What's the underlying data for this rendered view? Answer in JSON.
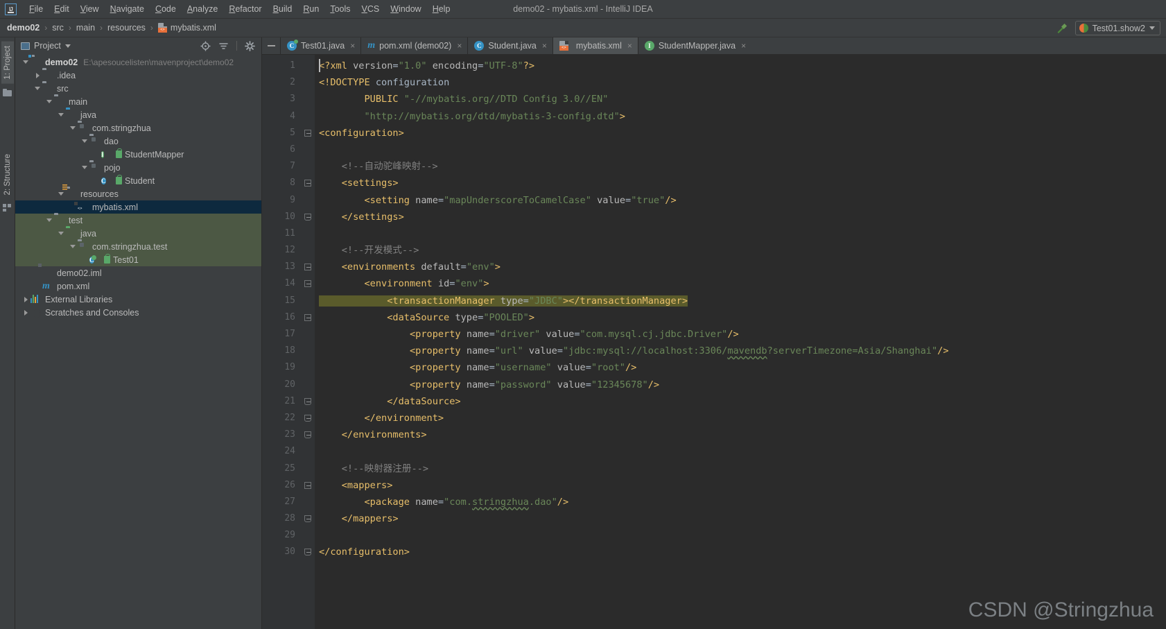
{
  "window": {
    "title": "demo02 - mybatis.xml - IntelliJ IDEA",
    "logo": "ij-logo"
  },
  "menu": [
    {
      "label": "File"
    },
    {
      "label": "Edit"
    },
    {
      "label": "View"
    },
    {
      "label": "Navigate"
    },
    {
      "label": "Code"
    },
    {
      "label": "Analyze"
    },
    {
      "label": "Refactor"
    },
    {
      "label": "Build"
    },
    {
      "label": "Run"
    },
    {
      "label": "Tools"
    },
    {
      "label": "VCS"
    },
    {
      "label": "Window"
    },
    {
      "label": "Help"
    }
  ],
  "breadcrumb": {
    "items": [
      {
        "label": "demo02",
        "bold": true
      },
      {
        "label": "src",
        "bold": false
      },
      {
        "label": "main",
        "bold": false
      },
      {
        "label": "resources",
        "bold": false
      },
      {
        "label": "mybatis.xml",
        "bold": false,
        "icon": "xml-file-icon"
      }
    ],
    "separator": "›"
  },
  "toolbar_right": {
    "build_icon": "hammer-icon",
    "run_config": "Test01.show2",
    "run_config_icon": "run-debug-icon",
    "dropdown_icon": "chevron-down-icon"
  },
  "rail": {
    "top_tab": "1: Project",
    "bottom_tab": "2: Structure"
  },
  "project_panel": {
    "title": "Project",
    "title_icon": "project-view-icon",
    "dropdown_icon": "chevron-down-icon",
    "actions": [
      {
        "name": "locate-icon"
      },
      {
        "name": "collapse-all-icon"
      },
      {
        "name": "gear-icon"
      }
    ],
    "tree": [
      {
        "indent": 0,
        "twisty": "down",
        "icon": "module-folder",
        "label": "demo02",
        "bold": true,
        "path": "E:\\apesoucelisten\\mavenproject\\demo02"
      },
      {
        "indent": 1,
        "twisty": "right",
        "icon": "folder",
        "label": ".idea"
      },
      {
        "indent": 1,
        "twisty": "down",
        "icon": "folder",
        "label": "src"
      },
      {
        "indent": 2,
        "twisty": "down",
        "icon": "folder",
        "label": "main"
      },
      {
        "indent": 3,
        "twisty": "down",
        "icon": "folder-source",
        "label": "java"
      },
      {
        "indent": 4,
        "twisty": "down",
        "icon": "package",
        "label": "com.stringzhua"
      },
      {
        "indent": 5,
        "twisty": "down",
        "icon": "package",
        "label": "dao"
      },
      {
        "indent": 6,
        "twisty": "none",
        "icon": "interface",
        "label": "StudentMapper",
        "lock": true
      },
      {
        "indent": 5,
        "twisty": "down",
        "icon": "package",
        "label": "pojo"
      },
      {
        "indent": 6,
        "twisty": "none",
        "icon": "class",
        "label": "Student",
        "lock": true
      },
      {
        "indent": 3,
        "twisty": "down",
        "icon": "folder-resources",
        "label": "resources"
      },
      {
        "indent": 4,
        "twisty": "none",
        "icon": "xml-file",
        "label": "mybatis.xml",
        "selected": true
      },
      {
        "indent": 2,
        "twisty": "down",
        "icon": "folder",
        "label": "test",
        "testroot": true
      },
      {
        "indent": 3,
        "twisty": "down",
        "icon": "folder-test",
        "label": "java",
        "testroot": true
      },
      {
        "indent": 4,
        "twisty": "down",
        "icon": "package",
        "label": "com.stringzhua.test",
        "testroot": true
      },
      {
        "indent": 5,
        "twisty": "none",
        "icon": "class-runnable",
        "label": "Test01",
        "lock": true,
        "testroot": true
      },
      {
        "indent": 1,
        "twisty": "none",
        "icon": "iml-file",
        "label": "demo02.iml"
      },
      {
        "indent": 1,
        "twisty": "none",
        "icon": "maven-file",
        "label": "pom.xml"
      },
      {
        "indent": 0,
        "twisty": "right",
        "icon": "libraries",
        "label": "External Libraries"
      },
      {
        "indent": 0,
        "twisty": "right",
        "icon": "scratches",
        "label": "Scratches and Consoles"
      }
    ]
  },
  "editor_tabs": {
    "minimize_icon": "minus-icon",
    "tabs": [
      {
        "label": "Test01.java",
        "icon": "java-runnable-class-icon",
        "active": false,
        "close": "×"
      },
      {
        "label": "pom.xml (demo02)",
        "icon": "maven-icon",
        "active": false,
        "close": "×"
      },
      {
        "label": "Student.java",
        "icon": "class-icon",
        "active": false,
        "close": "×"
      },
      {
        "label": "mybatis.xml",
        "icon": "xml-file-icon",
        "active": true,
        "close": "×"
      },
      {
        "label": "StudentMapper.java",
        "icon": "interface-icon",
        "active": false,
        "close": "×"
      }
    ]
  },
  "editor": {
    "language": "xml",
    "filename": "mybatis.xml",
    "first_line": 1,
    "last_line": 30,
    "caret_line": 1,
    "selection_line": 15,
    "lines": [
      {
        "n": 1,
        "fold": "none",
        "tokens": [
          {
            "t": "pi",
            "v": "<?xml "
          },
          {
            "t": "attr",
            "v": "version"
          },
          {
            "t": "plain",
            "v": "="
          },
          {
            "t": "str",
            "v": "\"1.0\""
          },
          {
            "t": "plain",
            "v": " "
          },
          {
            "t": "attr",
            "v": "encoding"
          },
          {
            "t": "plain",
            "v": "="
          },
          {
            "t": "str",
            "v": "\"UTF-8\""
          },
          {
            "t": "pi",
            "v": "?>"
          }
        ]
      },
      {
        "n": 2,
        "fold": "none",
        "tokens": [
          {
            "t": "tag",
            "v": "<!DOCTYPE"
          },
          {
            "t": "plain",
            "v": " configuration"
          }
        ]
      },
      {
        "n": 3,
        "fold": "none",
        "tokens": [
          {
            "t": "plain",
            "v": "        "
          },
          {
            "t": "tag",
            "v": "PUBLIC"
          },
          {
            "t": "plain",
            "v": " "
          },
          {
            "t": "str",
            "v": "\"-//mybatis.org//DTD Config 3.0//EN\""
          }
        ]
      },
      {
        "n": 4,
        "fold": "none",
        "tokens": [
          {
            "t": "plain",
            "v": "        "
          },
          {
            "t": "str",
            "v": "\"http://mybatis.org/dtd/mybatis-3-config.dtd\""
          },
          {
            "t": "tag",
            "v": ">"
          }
        ]
      },
      {
        "n": 5,
        "fold": "start",
        "tokens": [
          {
            "t": "tag",
            "v": "<configuration>"
          }
        ]
      },
      {
        "n": 6,
        "fold": "none",
        "tokens": []
      },
      {
        "n": 7,
        "fold": "none",
        "tokens": [
          {
            "t": "plain",
            "v": "    "
          },
          {
            "t": "cmt",
            "v": "<!--自动驼峰映射-->"
          }
        ]
      },
      {
        "n": 8,
        "fold": "start",
        "tokens": [
          {
            "t": "plain",
            "v": "    "
          },
          {
            "t": "tag",
            "v": "<settings>"
          }
        ]
      },
      {
        "n": 9,
        "fold": "none",
        "tokens": [
          {
            "t": "plain",
            "v": "        "
          },
          {
            "t": "tag",
            "v": "<setting"
          },
          {
            "t": "plain",
            "v": " "
          },
          {
            "t": "attr",
            "v": "name"
          },
          {
            "t": "plain",
            "v": "="
          },
          {
            "t": "str",
            "v": "\"mapUnderscoreToCamelCase\""
          },
          {
            "t": "plain",
            "v": " "
          },
          {
            "t": "attr",
            "v": "value"
          },
          {
            "t": "plain",
            "v": "="
          },
          {
            "t": "str",
            "v": "\"true\""
          },
          {
            "t": "tag",
            "v": "/>"
          }
        ]
      },
      {
        "n": 10,
        "fold": "end",
        "tokens": [
          {
            "t": "plain",
            "v": "    "
          },
          {
            "t": "tag",
            "v": "</settings>"
          }
        ]
      },
      {
        "n": 11,
        "fold": "none",
        "tokens": []
      },
      {
        "n": 12,
        "fold": "none",
        "tokens": [
          {
            "t": "plain",
            "v": "    "
          },
          {
            "t": "cmt",
            "v": "<!--开发模式-->"
          }
        ]
      },
      {
        "n": 13,
        "fold": "start",
        "tokens": [
          {
            "t": "plain",
            "v": "    "
          },
          {
            "t": "tag",
            "v": "<environments"
          },
          {
            "t": "plain",
            "v": " "
          },
          {
            "t": "attr",
            "v": "default"
          },
          {
            "t": "plain",
            "v": "="
          },
          {
            "t": "str",
            "v": "\"env\""
          },
          {
            "t": "tag",
            "v": ">"
          }
        ]
      },
      {
        "n": 14,
        "fold": "start",
        "tokens": [
          {
            "t": "plain",
            "v": "        "
          },
          {
            "t": "tag",
            "v": "<environment"
          },
          {
            "t": "plain",
            "v": " "
          },
          {
            "t": "attr",
            "v": "id"
          },
          {
            "t": "plain",
            "v": "="
          },
          {
            "t": "str",
            "v": "\"env\""
          },
          {
            "t": "tag",
            "v": ">"
          }
        ]
      },
      {
        "n": 15,
        "fold": "none",
        "selected": true,
        "tokens": [
          {
            "t": "plain",
            "v": "            "
          },
          {
            "t": "tag",
            "v": "<transactionManager"
          },
          {
            "t": "plain",
            "v": " "
          },
          {
            "t": "attr",
            "v": "type"
          },
          {
            "t": "plain",
            "v": "="
          },
          {
            "t": "str",
            "v": "\"JDBC\""
          },
          {
            "t": "tag",
            "v": "></transactionManager>"
          }
        ]
      },
      {
        "n": 16,
        "fold": "start",
        "tokens": [
          {
            "t": "plain",
            "v": "            "
          },
          {
            "t": "tag",
            "v": "<dataSource"
          },
          {
            "t": "plain",
            "v": " "
          },
          {
            "t": "attr",
            "v": "type"
          },
          {
            "t": "plain",
            "v": "="
          },
          {
            "t": "str",
            "v": "\"POOLED\""
          },
          {
            "t": "tag",
            "v": ">"
          }
        ]
      },
      {
        "n": 17,
        "fold": "none",
        "tokens": [
          {
            "t": "plain",
            "v": "                "
          },
          {
            "t": "tag",
            "v": "<property"
          },
          {
            "t": "plain",
            "v": " "
          },
          {
            "t": "attr",
            "v": "name"
          },
          {
            "t": "plain",
            "v": "="
          },
          {
            "t": "str",
            "v": "\"driver\""
          },
          {
            "t": "plain",
            "v": " "
          },
          {
            "t": "attr",
            "v": "value"
          },
          {
            "t": "plain",
            "v": "="
          },
          {
            "t": "str",
            "v": "\"com.mysql.cj.jdbc.Driver\""
          },
          {
            "t": "tag",
            "v": "/>"
          }
        ]
      },
      {
        "n": 18,
        "fold": "none",
        "tokens": [
          {
            "t": "plain",
            "v": "                "
          },
          {
            "t": "tag",
            "v": "<property"
          },
          {
            "t": "plain",
            "v": " "
          },
          {
            "t": "attr",
            "v": "name"
          },
          {
            "t": "plain",
            "v": "="
          },
          {
            "t": "str",
            "v": "\"url\""
          },
          {
            "t": "plain",
            "v": " "
          },
          {
            "t": "attr",
            "v": "value"
          },
          {
            "t": "plain",
            "v": "="
          },
          {
            "t": "str",
            "v": "\"jdbc:mysql://localhost:3306/"
          },
          {
            "t": "str-warn",
            "v": "mavendb"
          },
          {
            "t": "str",
            "v": "?serverTimezone=Asia/Shanghai\""
          },
          {
            "t": "tag",
            "v": "/>"
          }
        ]
      },
      {
        "n": 19,
        "fold": "none",
        "tokens": [
          {
            "t": "plain",
            "v": "                "
          },
          {
            "t": "tag",
            "v": "<property"
          },
          {
            "t": "plain",
            "v": " "
          },
          {
            "t": "attr",
            "v": "name"
          },
          {
            "t": "plain",
            "v": "="
          },
          {
            "t": "str",
            "v": "\"username\""
          },
          {
            "t": "plain",
            "v": " "
          },
          {
            "t": "attr",
            "v": "value"
          },
          {
            "t": "plain",
            "v": "="
          },
          {
            "t": "str",
            "v": "\"root\""
          },
          {
            "t": "tag",
            "v": "/>"
          }
        ]
      },
      {
        "n": 20,
        "fold": "none",
        "tokens": [
          {
            "t": "plain",
            "v": "                "
          },
          {
            "t": "tag",
            "v": "<property"
          },
          {
            "t": "plain",
            "v": " "
          },
          {
            "t": "attr",
            "v": "name"
          },
          {
            "t": "plain",
            "v": "="
          },
          {
            "t": "str",
            "v": "\"password\""
          },
          {
            "t": "plain",
            "v": " "
          },
          {
            "t": "attr",
            "v": "value"
          },
          {
            "t": "plain",
            "v": "="
          },
          {
            "t": "str",
            "v": "\"12345678\""
          },
          {
            "t": "tag",
            "v": "/>"
          }
        ]
      },
      {
        "n": 21,
        "fold": "end",
        "tokens": [
          {
            "t": "plain",
            "v": "            "
          },
          {
            "t": "tag",
            "v": "</dataSource>"
          }
        ]
      },
      {
        "n": 22,
        "fold": "end",
        "tokens": [
          {
            "t": "plain",
            "v": "        "
          },
          {
            "t": "tag",
            "v": "</environment>"
          }
        ]
      },
      {
        "n": 23,
        "fold": "end",
        "tokens": [
          {
            "t": "plain",
            "v": "    "
          },
          {
            "t": "tag",
            "v": "</environments>"
          }
        ]
      },
      {
        "n": 24,
        "fold": "none",
        "tokens": []
      },
      {
        "n": 25,
        "fold": "none",
        "tokens": [
          {
            "t": "plain",
            "v": "    "
          },
          {
            "t": "cmt",
            "v": "<!--映射器注册-->"
          }
        ]
      },
      {
        "n": 26,
        "fold": "start",
        "tokens": [
          {
            "t": "plain",
            "v": "    "
          },
          {
            "t": "tag",
            "v": "<mappers>"
          }
        ]
      },
      {
        "n": 27,
        "fold": "none",
        "tokens": [
          {
            "t": "plain",
            "v": "        "
          },
          {
            "t": "tag",
            "v": "<package"
          },
          {
            "t": "plain",
            "v": " "
          },
          {
            "t": "attr",
            "v": "name"
          },
          {
            "t": "plain",
            "v": "="
          },
          {
            "t": "str",
            "v": "\"com."
          },
          {
            "t": "str-warn",
            "v": "stringzhua"
          },
          {
            "t": "str",
            "v": ".dao\""
          },
          {
            "t": "tag",
            "v": "/>"
          }
        ]
      },
      {
        "n": 28,
        "fold": "end",
        "tokens": [
          {
            "t": "plain",
            "v": "    "
          },
          {
            "t": "tag",
            "v": "</mappers>"
          }
        ]
      },
      {
        "n": 29,
        "fold": "none",
        "tokens": []
      },
      {
        "n": 30,
        "fold": "end",
        "tokens": [
          {
            "t": "tag",
            "v": "</configuration>"
          }
        ]
      }
    ]
  },
  "watermark": "CSDN @Stringzhua",
  "colors": {
    "bg_panel": "#3c3f41",
    "bg_editor": "#2b2b2b",
    "gutter": "#313335",
    "selection_tree": "#0d293e",
    "testroot": "#4c5844",
    "tag": "#e8bf6a",
    "string": "#6a8759",
    "comment": "#808080",
    "attr": "#bababa",
    "selection_code": "#5a5b2b",
    "accent_blue": "#3592c4",
    "accent_green": "#59a869",
    "accent_orange": "#e8703a"
  }
}
